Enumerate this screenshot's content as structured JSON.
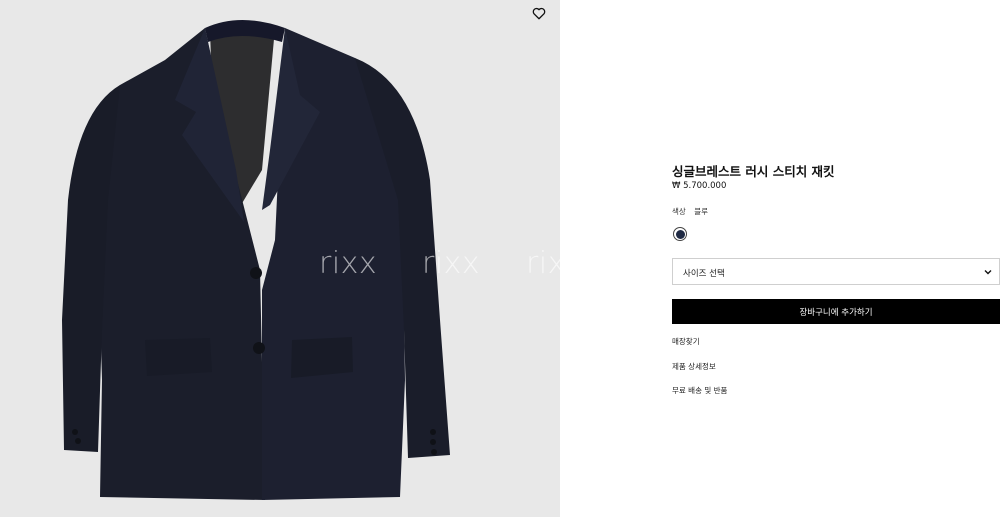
{
  "gallery": {
    "watermarks": [
      "rixx",
      "rixx",
      "rixx"
    ],
    "wishlist_icon": "heart-icon",
    "background_color": "#e8e8e8",
    "jacket_color": "#1b1e2b"
  },
  "product": {
    "title": "싱글브레스트 러시 스티치 재킷",
    "price": "₩ 5.700.000",
    "color_label": "색상",
    "color_value": "블루",
    "swatch_color": "#1f2a44",
    "size_placeholder": "사이즈 선택",
    "chevron_icon": "chevron-down-icon",
    "add_to_cart": "장바구니에 추가하기",
    "links": [
      "매장찾기",
      "제품 상세정보",
      "무료 배송 및 반품"
    ]
  }
}
